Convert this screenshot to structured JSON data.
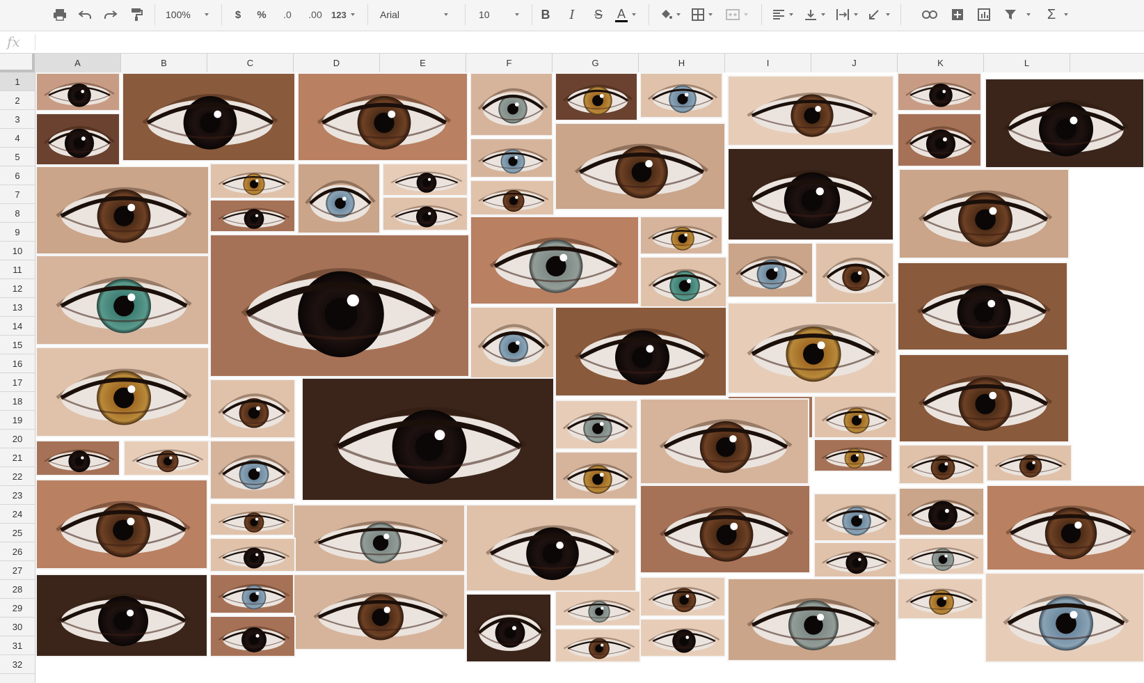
{
  "toolbar": {
    "zoom": "100%",
    "currency": "$",
    "percent": "%",
    "decrease_decimals": ".0",
    "increase_decimals": ".00",
    "more_formats": "123",
    "font_family": "Arial",
    "font_size": "10",
    "bold": "B",
    "italic": "I",
    "strikethrough": "S",
    "text_color": "A",
    "text_color_value": "#000000",
    "sum": "Σ"
  },
  "formula_bar": {
    "label": "fx",
    "value": ""
  },
  "columns": [
    "A",
    "B",
    "C",
    "D",
    "E",
    "F",
    "G",
    "H",
    "I",
    "J",
    "K",
    "L"
  ],
  "selected_column": "A",
  "rows": [
    "1",
    "2",
    "3",
    "4",
    "5",
    "6",
    "7",
    "8",
    "9",
    "10",
    "11",
    "12",
    "13",
    "14",
    "15",
    "16",
    "17",
    "18",
    "19",
    "20",
    "21",
    "22",
    "23",
    "24",
    "25",
    "26",
    "27",
    "28",
    "29",
    "30",
    "31",
    "32"
  ],
  "selected_row": "1",
  "image_content": "collage of close-up human eye photographs placed over the sheet",
  "colors": {
    "toolbar_bg": "#f5f5f5",
    "header_bg": "#f3f3f3",
    "header_selected": "#dedede"
  }
}
